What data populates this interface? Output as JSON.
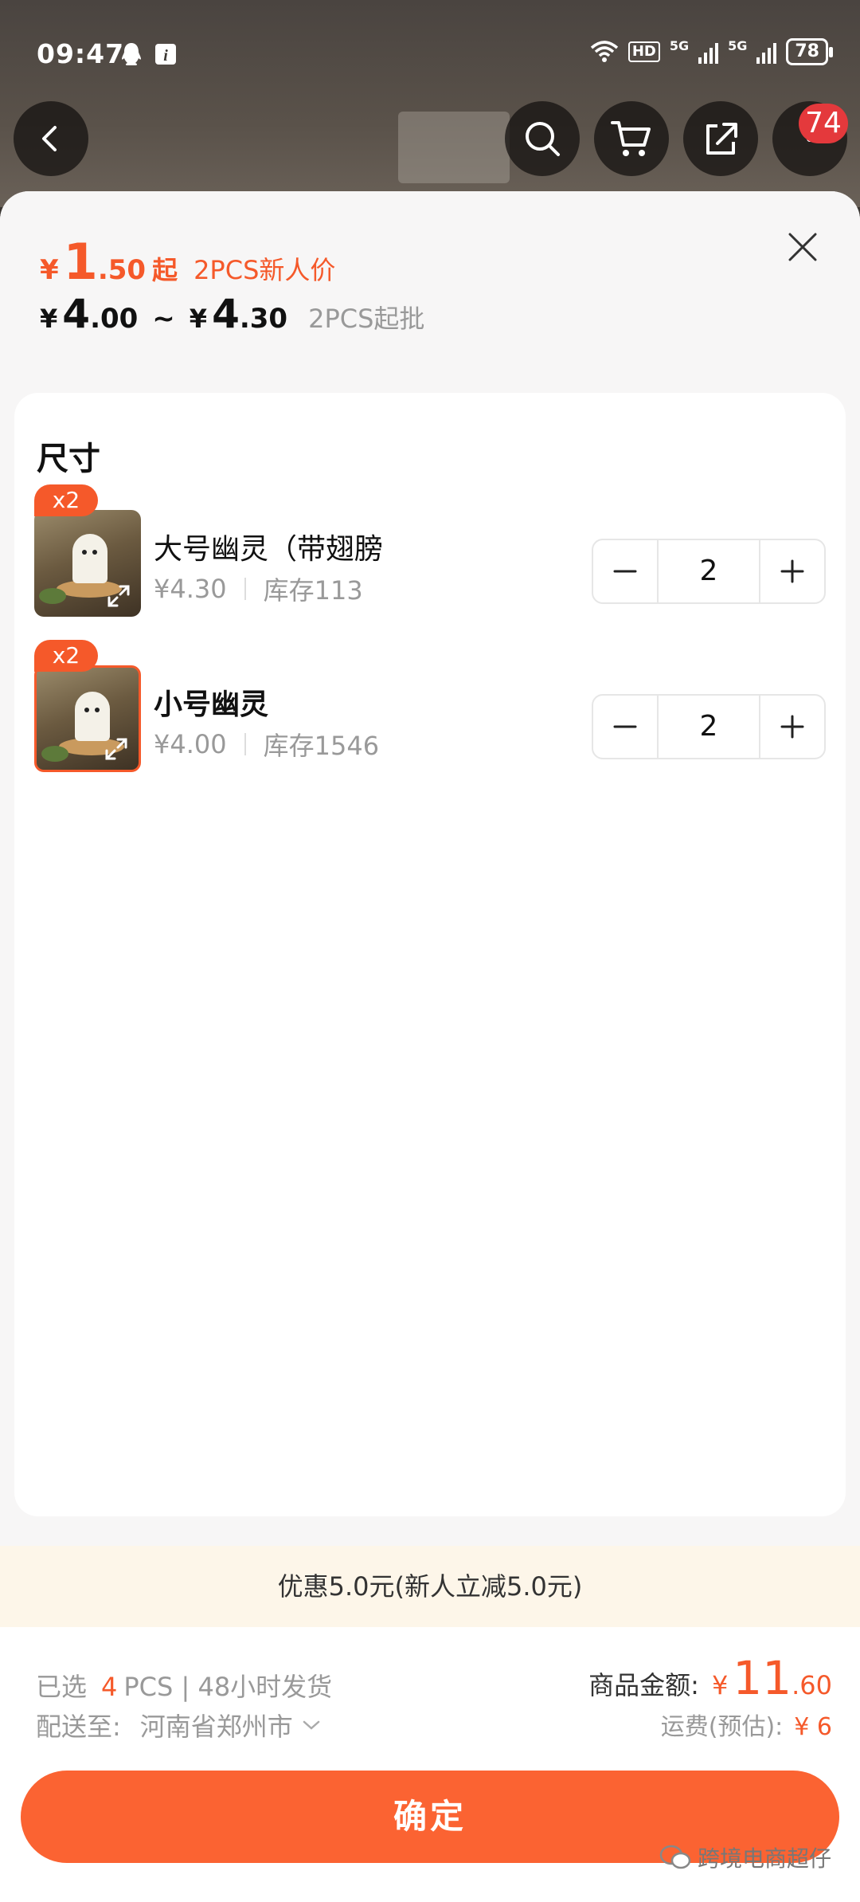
{
  "status_bar": {
    "time": "09:47",
    "hd_label": "HD",
    "network_1": "5G",
    "network_2": "5G",
    "battery": "78"
  },
  "nav": {
    "notification_count": "74"
  },
  "price_header": {
    "promo_currency": "¥",
    "promo_int": "1",
    "promo_dec": ".50",
    "promo_suffix": "起",
    "promo_tag": "2PCS新人价",
    "range_currency_1": "¥",
    "range_int_1": "4",
    "range_dec_1": ".00",
    "range_sep": "~",
    "range_currency_2": "¥",
    "range_int_2": "4",
    "range_dec_2": ".30",
    "moq": "2PCS起批"
  },
  "sku_section": {
    "title": "尺寸",
    "items": [
      {
        "badge": "x2",
        "name": "大号幽灵（带翅膀",
        "price": "¥4.30",
        "stock": "库存113",
        "quantity": "2"
      },
      {
        "badge": "x2",
        "name": "小号幽灵",
        "price": "¥4.00",
        "stock": "库存1546",
        "quantity": "2"
      }
    ]
  },
  "discount": {
    "text": "优惠5.0元(新人立减5.0元)"
  },
  "summary": {
    "selected_prefix": "已选",
    "selected_qty": "4",
    "selected_unit": "PCS | 48小时发货",
    "ship_to_label": "配送至:",
    "ship_to_address": "河南省郑州市",
    "amount_label": "商品金额:",
    "amount_currency": "¥",
    "amount_int": "11",
    "amount_dec": ".60",
    "shipping_label": "运费(预估):",
    "shipping_value": "¥ 6"
  },
  "confirm_label": "确定",
  "watermark": "跨境电商超仔",
  "colors": {
    "accent": "#f5592a",
    "button": "#fb6332",
    "discount_bg": "#fdf6e9",
    "sheet_bg": "#f7f6f6"
  }
}
